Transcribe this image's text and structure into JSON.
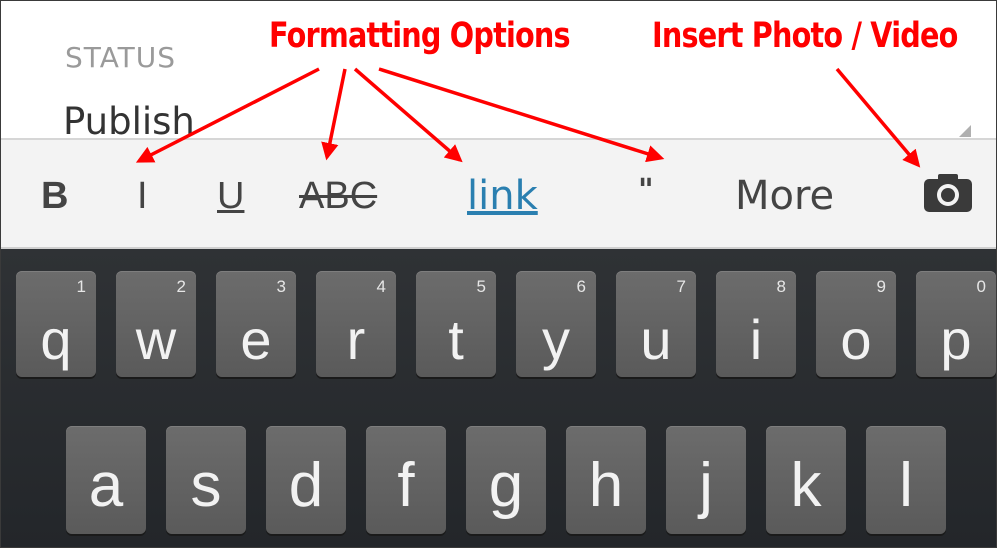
{
  "status": {
    "label": "STATUS",
    "value": "Publish"
  },
  "toolbar": {
    "bold": "B",
    "italic": "I",
    "underline": "U",
    "strikethrough": "ABC",
    "link": "link",
    "quote": "\"",
    "more": "More",
    "camera_icon": "camera-icon"
  },
  "keyboard": {
    "row1": [
      {
        "char": "q",
        "hint": "1"
      },
      {
        "char": "w",
        "hint": "2"
      },
      {
        "char": "e",
        "hint": "3"
      },
      {
        "char": "r",
        "hint": "4"
      },
      {
        "char": "t",
        "hint": "5"
      },
      {
        "char": "y",
        "hint": "6"
      },
      {
        "char": "u",
        "hint": "7"
      },
      {
        "char": "i",
        "hint": "8"
      },
      {
        "char": "o",
        "hint": "9"
      },
      {
        "char": "p",
        "hint": "0"
      }
    ],
    "row2": [
      {
        "char": "a"
      },
      {
        "char": "s"
      },
      {
        "char": "d"
      },
      {
        "char": "f"
      },
      {
        "char": "g"
      },
      {
        "char": "h"
      },
      {
        "char": "j"
      },
      {
        "char": "k"
      },
      {
        "char": "l"
      }
    ]
  },
  "annotations": {
    "formatting": "Formatting Options",
    "insert": "Insert Photo / Video",
    "color": "#ff0000"
  },
  "colors": {
    "link": "#2a7fb0",
    "keyboard_bg": "#2a2d30",
    "key": "#626262"
  }
}
